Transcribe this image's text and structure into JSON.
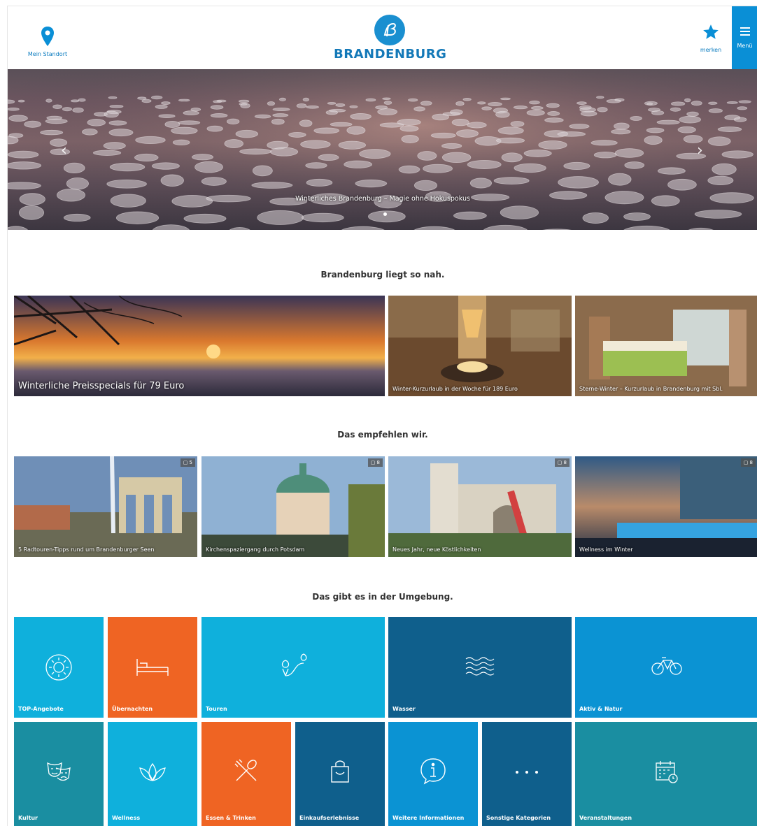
{
  "header": {
    "location_label": "Mein Standort",
    "brand_name": "BRANDENBURG",
    "bookmark_label": "merken",
    "menu_label": "Menü"
  },
  "hero": {
    "caption": "Winterliches Brandenburg – Magie ohne Hokuspokus"
  },
  "sections": {
    "near": "Brandenburg liegt so nah.",
    "recommend": "Das empfehlen wir.",
    "around": "Das gibt es in der Umgebung."
  },
  "offers": [
    {
      "title": "Winterliche Preisspecials für 79 Euro"
    },
    {
      "title": "Winter-Kurzurlaub in der Woche für 189 Euro"
    },
    {
      "title": "Sterne-Winter – Kurzurlaub in Brandenburg mit Sbl."
    }
  ],
  "recommendations": [
    {
      "title": "5 Radtouren-Tipps rund um Brandenburger Seen",
      "count": "5"
    },
    {
      "title": "Kirchenspaziergang durch Potsdam",
      "count": "8"
    },
    {
      "title": "Neues Jahr, neue Köstlichkeiten",
      "count": "8"
    },
    {
      "title": "Wellness im Winter",
      "count": "8"
    }
  ],
  "categories": [
    {
      "label": "TOP-Angebote",
      "icon": "sun-icon",
      "color": "#0fb0dc"
    },
    {
      "label": "Übernachten",
      "icon": "bed-icon",
      "color": "#ef6423"
    },
    {
      "label": "Touren",
      "icon": "route-icon",
      "color": "#0fb0dc"
    },
    {
      "label": "Wasser",
      "icon": "waves-icon",
      "color": "#0f5f8c"
    },
    {
      "label": "Aktiv & Natur",
      "icon": "bicycle-icon",
      "color": "#0b93d3"
    },
    {
      "label": "Kultur",
      "icon": "theatre-masks-icon",
      "color": "#1a8ea1"
    },
    {
      "label": "Wellness",
      "icon": "lotus-icon",
      "color": "#0fb0dc"
    },
    {
      "label": "Essen & Trinken",
      "icon": "fork-spoon-icon",
      "color": "#ef6423"
    },
    {
      "label": "Einkaufserlebnisse",
      "icon": "shopping-bag-icon",
      "color": "#0f5f8c"
    },
    {
      "label": "Weitere Informationen",
      "icon": "info-icon",
      "color": "#0b93d3"
    },
    {
      "label": "Sonstige Kategorien",
      "icon": "more-dots-icon",
      "color": "#0f5f8c"
    },
    {
      "label": "Veranstaltungen",
      "icon": "calendar-icon",
      "color": "#1a8ea1"
    }
  ]
}
